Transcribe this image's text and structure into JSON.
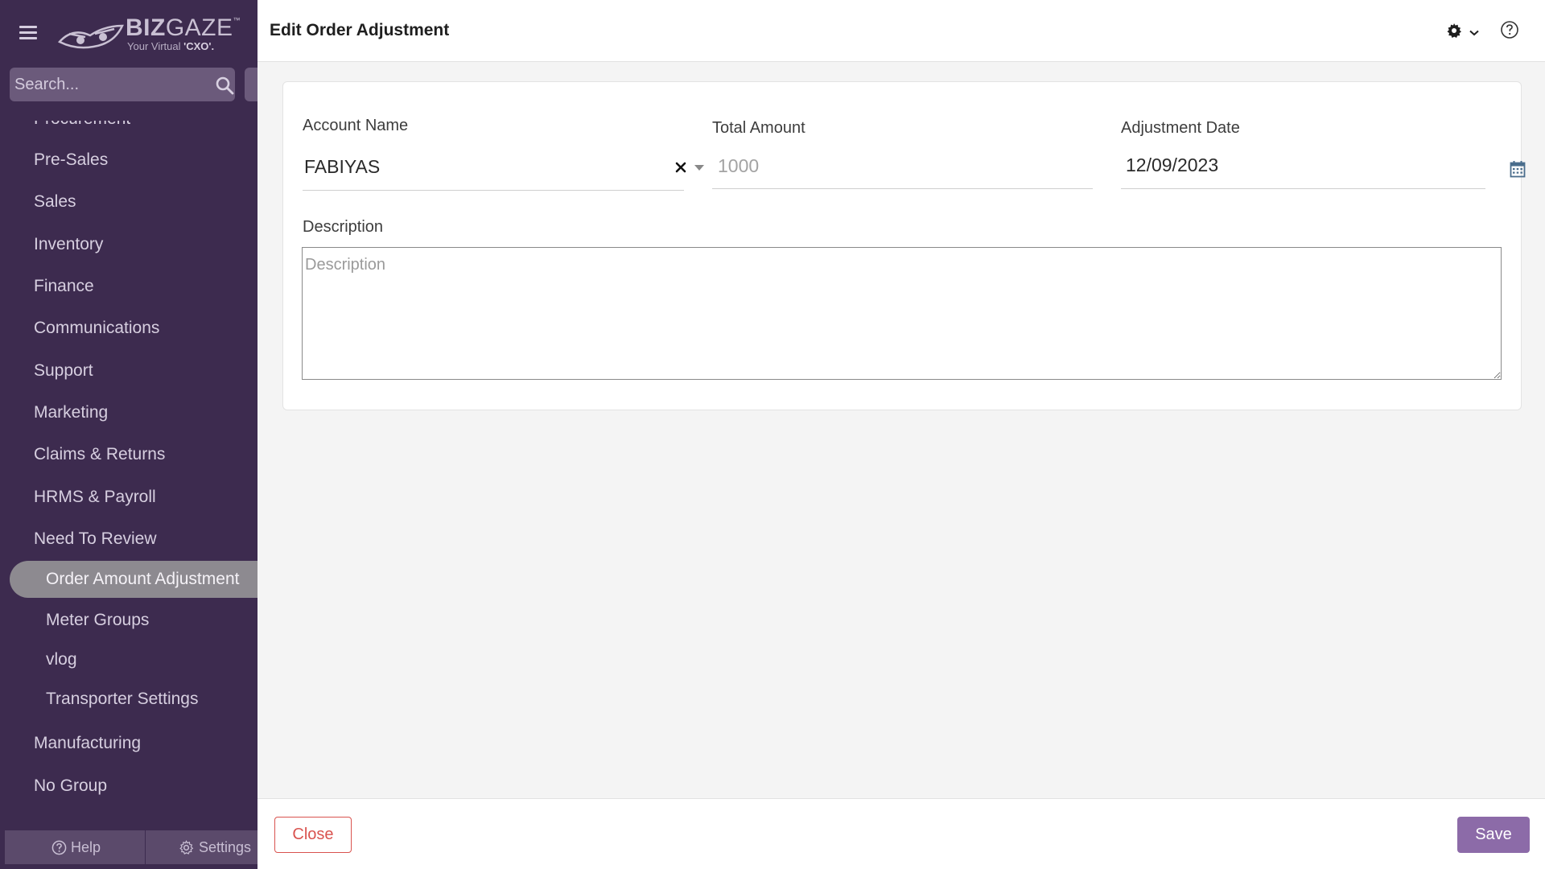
{
  "sidebar": {
    "logo": {
      "brand_light": "BIZ",
      "brand_bold": "GAZE",
      "trademark": "™",
      "tagline_prefix": "Your Virtual ",
      "tagline_bold": "'CXO'."
    },
    "search": {
      "placeholder": "Search..."
    },
    "partial_item": "Procurement",
    "items": [
      "Pre-Sales",
      "Sales",
      "Inventory",
      "Finance",
      "Communications",
      "Support",
      "Marketing",
      "Claims & Returns",
      "HRMS & Payroll",
      "Need To Review"
    ],
    "sub_items": {
      "active": "Order Amount Adjustment",
      "others": [
        "Meter Groups",
        "vlog",
        "Transporter Settings"
      ]
    },
    "after_items": [
      "Manufacturing",
      "No Group"
    ],
    "footer": {
      "help_label": "Help",
      "settings_label": "Settings"
    }
  },
  "header": {
    "title": "Edit Order Adjustment"
  },
  "form": {
    "account_name": {
      "label": "Account Name",
      "value": "FABIYAS"
    },
    "total_amount": {
      "label": "Total Amount",
      "value": "1000"
    },
    "adjustment_date": {
      "label": "Adjustment Date",
      "value": "12/09/2023"
    },
    "description": {
      "label": "Description",
      "placeholder": "Description",
      "value": ""
    }
  },
  "footer": {
    "close_label": "Close",
    "save_label": "Save"
  },
  "colors": {
    "sidebar_bg": "#3d2b4f",
    "accent": "#8c6ba8",
    "danger": "#d9534f",
    "calendar_icon": "#4a6d8c"
  }
}
